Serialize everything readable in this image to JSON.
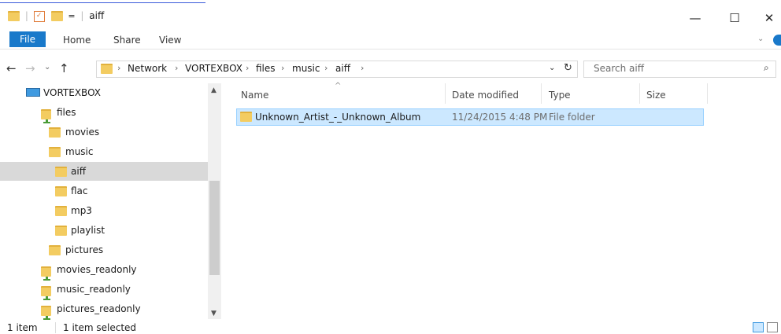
{
  "window": {
    "title": "aiff",
    "controls": {
      "minimize": "—",
      "maximize": "☐",
      "close": "✕"
    }
  },
  "ribbon": {
    "file": "File",
    "tabs": [
      "Home",
      "Share",
      "View"
    ]
  },
  "address": {
    "crumbs": [
      "Network",
      "VORTEXBOX",
      "files",
      "music",
      "aiff"
    ],
    "search_placeholder": "Search aiff"
  },
  "nav": {
    "items": [
      {
        "label": "VORTEXBOX",
        "icon": "computer-icon"
      },
      {
        "label": "files",
        "icon": "network-folder-icon"
      },
      {
        "label": "movies",
        "icon": "folder-icon"
      },
      {
        "label": "music",
        "icon": "folder-icon"
      },
      {
        "label": "aiff",
        "icon": "folder-icon",
        "selected": true
      },
      {
        "label": "flac",
        "icon": "folder-icon"
      },
      {
        "label": "mp3",
        "icon": "folder-icon"
      },
      {
        "label": "playlist",
        "icon": "folder-icon"
      },
      {
        "label": "pictures",
        "icon": "folder-icon"
      },
      {
        "label": "movies_readonly",
        "icon": "network-folder-icon"
      },
      {
        "label": "music_readonly",
        "icon": "network-folder-icon"
      },
      {
        "label": "pictures_readonly",
        "icon": "network-folder-icon"
      }
    ]
  },
  "columns": {
    "name": "Name",
    "date": "Date modified",
    "type": "Type",
    "size": "Size"
  },
  "files": [
    {
      "name": "Unknown_Artist_-_Unknown_Album",
      "date": "11/24/2015 4:48 PM",
      "type": "File folder",
      "size": ""
    }
  ],
  "status": {
    "count": "1 item",
    "selected": "1 item selected"
  },
  "colors": {
    "accent": "#1979ca",
    "selection": "#cce8ff",
    "folder": "#f3cc61"
  }
}
